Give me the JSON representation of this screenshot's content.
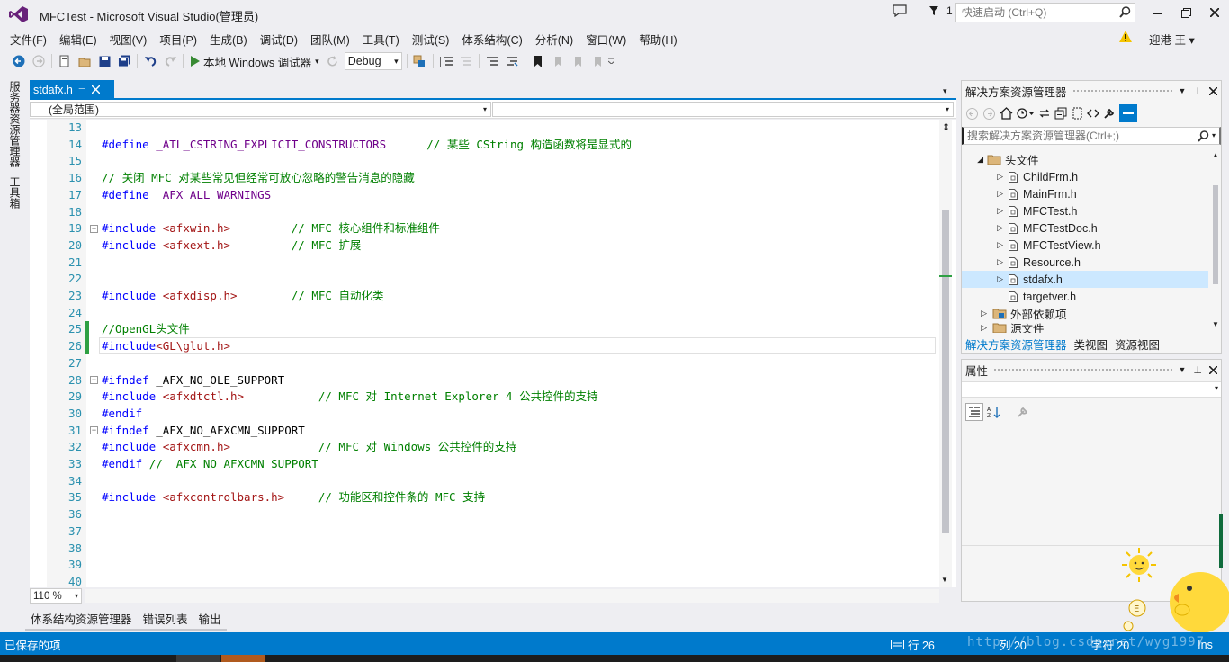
{
  "window": {
    "title": "MFCTest - Microsoft Visual Studio(管理员)",
    "notification_count": "1",
    "quick_launch_placeholder": "快速启动 (Ctrl+Q)",
    "user": "迎港 王"
  },
  "menu": [
    "文件(F)",
    "编辑(E)",
    "视图(V)",
    "项目(P)",
    "生成(B)",
    "调试(D)",
    "团队(M)",
    "工具(T)",
    "测试(S)",
    "体系结构(C)",
    "分析(N)",
    "窗口(W)",
    "帮助(H)"
  ],
  "toolbar": {
    "run_label": "本地 Windows 调试器",
    "configuration": "Debug"
  },
  "side_tabs": [
    "服务器资源管理器",
    "工具箱"
  ],
  "editor": {
    "tab": "stdafx.h",
    "scope": "(全局范围)",
    "zoom": "110 %",
    "lines": [
      {
        "n": "13",
        "text": ""
      },
      {
        "n": "14",
        "text": "#define _ATL_CSTRING_EXPLICIT_CONSTRUCTORS      // 某些 CString 构造函数将是显式的"
      },
      {
        "n": "15",
        "text": ""
      },
      {
        "n": "16",
        "text": "// 关闭 MFC 对某些常见但经常可放心忽略的警告消息的隐藏"
      },
      {
        "n": "17",
        "text": "#define _AFX_ALL_WARNINGS"
      },
      {
        "n": "18",
        "text": ""
      },
      {
        "n": "19",
        "text": "#include <afxwin.h>         // MFC 核心组件和标准组件"
      },
      {
        "n": "20",
        "text": "#include <afxext.h>         // MFC 扩展"
      },
      {
        "n": "21",
        "text": ""
      },
      {
        "n": "22",
        "text": ""
      },
      {
        "n": "23",
        "text": "#include <afxdisp.h>        // MFC 自动化类"
      },
      {
        "n": "24",
        "text": ""
      },
      {
        "n": "25",
        "text": "//OpenGL头文件"
      },
      {
        "n": "26",
        "text": "#include<GL\\glut.h>"
      },
      {
        "n": "27",
        "text": ""
      },
      {
        "n": "28",
        "text": "#ifndef _AFX_NO_OLE_SUPPORT"
      },
      {
        "n": "29",
        "text": "#include <afxdtctl.h>           // MFC 对 Internet Explorer 4 公共控件的支持"
      },
      {
        "n": "30",
        "text": "#endif"
      },
      {
        "n": "31",
        "text": "#ifndef _AFX_NO_AFXCMN_SUPPORT"
      },
      {
        "n": "32",
        "text": "#include <afxcmn.h>             // MFC 对 Windows 公共控件的支持"
      },
      {
        "n": "33",
        "text": "#endif // _AFX_NO_AFXCMN_SUPPORT"
      },
      {
        "n": "34",
        "text": ""
      },
      {
        "n": "35",
        "text": "#include <afxcontrolbars.h>     // 功能区和控件条的 MFC 支持"
      },
      {
        "n": "36",
        "text": ""
      },
      {
        "n": "37",
        "text": ""
      },
      {
        "n": "38",
        "text": ""
      },
      {
        "n": "39",
        "text": ""
      },
      {
        "n": "40",
        "text": ""
      }
    ]
  },
  "bottom_tabs": [
    "体系结构资源管理器",
    "错误列表",
    "输出"
  ],
  "solution_explorer": {
    "title": "解决方案资源管理器",
    "search_placeholder": "搜索解决方案资源管理器(Ctrl+;)",
    "items": [
      {
        "label": "头文件",
        "kind": "folder",
        "expanded": true
      },
      {
        "label": "ChildFrm.h",
        "kind": "file"
      },
      {
        "label": "MainFrm.h",
        "kind": "file"
      },
      {
        "label": "MFCTest.h",
        "kind": "file"
      },
      {
        "label": "MFCTestDoc.h",
        "kind": "file"
      },
      {
        "label": "MFCTestView.h",
        "kind": "file"
      },
      {
        "label": "Resource.h",
        "kind": "file"
      },
      {
        "label": "stdafx.h",
        "kind": "file",
        "selected": true
      },
      {
        "label": "targetver.h",
        "kind": "file"
      },
      {
        "label": "外部依赖项",
        "kind": "folder"
      },
      {
        "label": "源文件",
        "kind": "folder"
      }
    ],
    "tabs": [
      "解决方案资源管理器",
      "类视图",
      "资源视图"
    ]
  },
  "properties": {
    "title": "属性"
  },
  "status": {
    "message": "已保存的项",
    "line": "行 26",
    "col": "列 20",
    "char": "字符 20",
    "mode": "Ins"
  },
  "watermark": "http://blog.csdn.net/wyg1997",
  "colors": {
    "accent": "#007acc",
    "keyword": "#0000ff",
    "string": "#a31515",
    "comment": "#008000",
    "line_number": "#2b91af",
    "change_marker": "#2ea043"
  }
}
